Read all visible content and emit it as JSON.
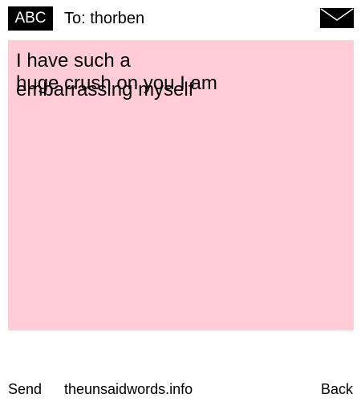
{
  "header": {
    "input_mode": "ABC",
    "to_label": "To:",
    "recipient": "thorben",
    "envelope_icon": "envelope-icon"
  },
  "message": {
    "lines": [
      "I have such a",
      "huge crush on you I am",
      "embarrassing myself"
    ],
    "background_color": "#ffccd7"
  },
  "footer": {
    "send_label": "Send",
    "site": "theunsaidwords.info",
    "back_label": "Back"
  }
}
